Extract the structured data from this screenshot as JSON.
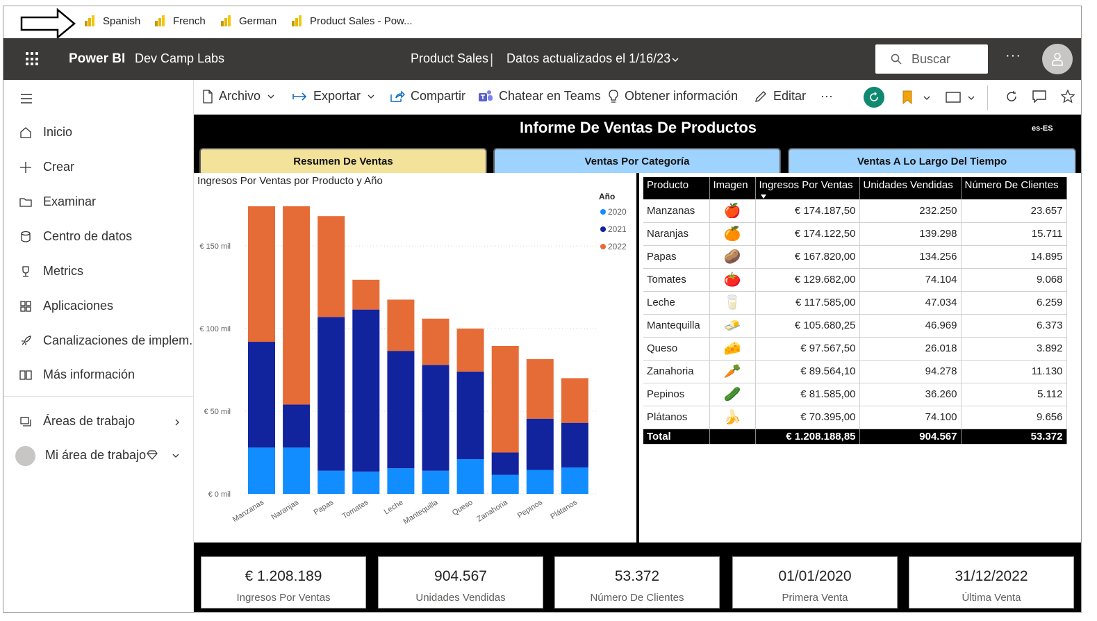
{
  "bookmarks": [
    "Spanish",
    "French",
    "German",
    "Product Sales - Pow..."
  ],
  "header": {
    "brand": "Power BI",
    "workspace": "Dev Camp Labs",
    "report": "Product Sales",
    "separator": "|",
    "updated": "Datos actualizados el 1/16/23",
    "search_placeholder": "Buscar",
    "more": "···"
  },
  "nav": {
    "items": [
      {
        "label": "Inicio",
        "icon": "home-icon"
      },
      {
        "label": "Crear",
        "icon": "plus-icon"
      },
      {
        "label": "Examinar",
        "icon": "folder-icon"
      },
      {
        "label": "Centro de datos",
        "icon": "database-icon"
      },
      {
        "label": "Metrics",
        "icon": "trophy-icon"
      },
      {
        "label": "Aplicaciones",
        "icon": "apps-icon"
      },
      {
        "label": "Canalizaciones de implem...",
        "icon": "rocket-icon"
      },
      {
        "label": "Más información",
        "icon": "book-icon"
      }
    ],
    "workspaces": "Áreas de trabajo",
    "my_workspace": "Mi área de trabajo"
  },
  "toolbar": {
    "file": "Archivo",
    "export": "Exportar",
    "share": "Compartir",
    "teams": "Chatear en Teams",
    "insights": "Obtener información",
    "edit": "Editar",
    "more": "···"
  },
  "report": {
    "title": "Informe De Ventas De Productos",
    "locale": "es-ES",
    "tabs": [
      "Resumen De Ventas",
      "Ventas Por Categoría",
      "Ventas A Lo Largo Del Tiempo"
    ]
  },
  "colors": {
    "y2020": "#118dff",
    "y2021": "#12239e",
    "y2022": "#e66c37",
    "tab_active": "#f2e29a",
    "tab_inactive": "#9fd3ff"
  },
  "chart_data": {
    "type": "bar",
    "stacked": true,
    "title": "Ingresos Por Ventas por Producto y Año",
    "legend_title": "Año",
    "legend_position": "top-right",
    "categories": [
      "Manzanas",
      "Naranjas",
      "Papas",
      "Tomates",
      "Leche",
      "Mantequilla",
      "Queso",
      "Zanahoria",
      "Pepinos",
      "Plátanos"
    ],
    "series": [
      {
        "name": "2020",
        "values": [
          28,
          28,
          14,
          13.5,
          15.5,
          14,
          21,
          11.5,
          14.5,
          16
        ]
      },
      {
        "name": "2021",
        "values": [
          64,
          26,
          93,
          98,
          71,
          64,
          53,
          13.5,
          31,
          27
        ]
      },
      {
        "name": "2022",
        "values": [
          82,
          120,
          61,
          18,
          31,
          28,
          26,
          64.5,
          36,
          27
        ]
      }
    ],
    "y_ticks": [
      "€ 0 mil",
      "€ 50 mil",
      "€ 100 mil",
      "€ 150 mil"
    ],
    "y_tick_values": [
      0,
      50,
      100,
      150
    ],
    "ylim": [
      0,
      180
    ],
    "grid": true
  },
  "table": {
    "headers": [
      "Producto",
      "Imagen",
      "Ingresos Por Ventas",
      "Unidades Vendidas",
      "Número De Clientes"
    ],
    "rows": [
      {
        "product": "Manzanas",
        "img": "🍎",
        "revenue": "€ 174.187,50",
        "units": "232.250",
        "customers": "23.657"
      },
      {
        "product": "Naranjas",
        "img": "🍊",
        "revenue": "€ 174.122,50",
        "units": "139.298",
        "customers": "15.711"
      },
      {
        "product": "Papas",
        "img": "🥔",
        "revenue": "€ 167.820,00",
        "units": "134.256",
        "customers": "14.895"
      },
      {
        "product": "Tomates",
        "img": "🍅",
        "revenue": "€ 129.682,00",
        "units": "74.104",
        "customers": "9.068"
      },
      {
        "product": "Leche",
        "img": "🥛",
        "revenue": "€ 117.585,00",
        "units": "47.034",
        "customers": "6.259"
      },
      {
        "product": "Mantequilla",
        "img": "🧈",
        "revenue": "€ 105.680,25",
        "units": "46.969",
        "customers": "6.373"
      },
      {
        "product": "Queso",
        "img": "🧀",
        "revenue": "€ 97.567,50",
        "units": "26.018",
        "customers": "3.892"
      },
      {
        "product": "Zanahoria",
        "img": "🥕",
        "revenue": "€ 89.564,10",
        "units": "94.278",
        "customers": "11.130"
      },
      {
        "product": "Pepinos",
        "img": "🥒",
        "revenue": "€ 81.585,00",
        "units": "36.260",
        "customers": "5.112"
      },
      {
        "product": "Plátanos",
        "img": "🍌",
        "revenue": "€ 70.395,00",
        "units": "74.100",
        "customers": "9.656"
      }
    ],
    "total": {
      "label": "Total",
      "revenue": "€ 1.208.188,85",
      "units": "904.567",
      "customers": "53.372"
    }
  },
  "kpis": [
    {
      "value": "€ 1.208.189",
      "label": "Ingresos Por Ventas"
    },
    {
      "value": "904.567",
      "label": "Unidades Vendidas"
    },
    {
      "value": "53.372",
      "label": "Número De Clientes"
    },
    {
      "value": "01/01/2020",
      "label": "Primera Venta"
    },
    {
      "value": "31/12/2022",
      "label": "Última Venta"
    }
  ]
}
